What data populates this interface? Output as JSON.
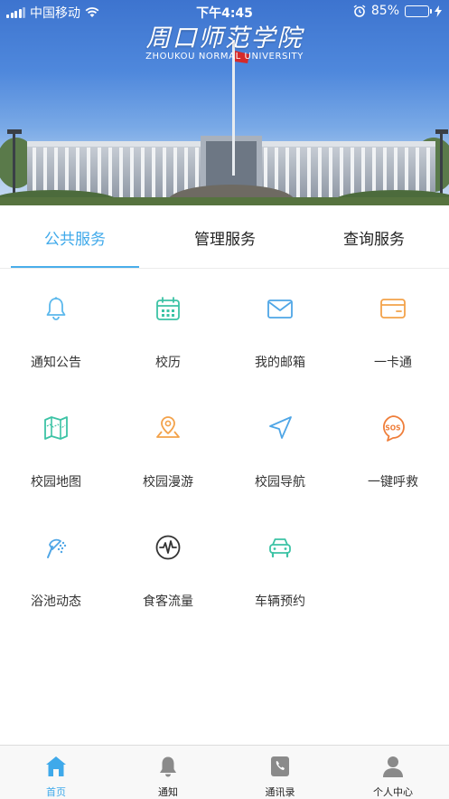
{
  "status_bar": {
    "carrier": "中国移动",
    "time": "下午4:45",
    "battery_percent": "85%",
    "battery_level": 0.85
  },
  "hero": {
    "title": "周口师范学院",
    "subtitle": "ZHOUKOU NORMAL UNIVERSITY"
  },
  "tabs": [
    {
      "label": "公共服务",
      "active": true
    },
    {
      "label": "管理服务",
      "active": false
    },
    {
      "label": "查询服务",
      "active": false
    }
  ],
  "services": [
    {
      "label": "通知公告",
      "icon": "bell-icon",
      "color": "#5bb8ec"
    },
    {
      "label": "校历",
      "icon": "calendar-icon",
      "color": "#3cc3a5"
    },
    {
      "label": "我的邮箱",
      "icon": "mail-icon",
      "color": "#4fa6e6"
    },
    {
      "label": "一卡通",
      "icon": "card-icon",
      "color": "#f3a24a"
    },
    {
      "label": "校园地图",
      "icon": "map-icon",
      "color": "#3cc3a5"
    },
    {
      "label": "校园漫游",
      "icon": "location-pin-icon",
      "color": "#f3a24a"
    },
    {
      "label": "校园导航",
      "icon": "navigation-arrow-icon",
      "color": "#4fa6e6"
    },
    {
      "label": "一键呼救",
      "icon": "sos-icon",
      "color": "#ef7e3a"
    },
    {
      "label": "浴池动态",
      "icon": "shower-icon",
      "color": "#4fa6e6"
    },
    {
      "label": "食客流量",
      "icon": "pulse-icon",
      "color": "#333333"
    },
    {
      "label": "车辆预约",
      "icon": "car-icon",
      "color": "#3cc3a5"
    }
  ],
  "bottom_nav": [
    {
      "label": "首页",
      "icon": "home-icon",
      "active": true
    },
    {
      "label": "通知",
      "icon": "bell-icon",
      "active": false
    },
    {
      "label": "通讯录",
      "icon": "contacts-icon",
      "active": false
    },
    {
      "label": "个人中心",
      "icon": "user-icon",
      "active": false
    }
  ],
  "colors": {
    "accent": "#3fa9ea",
    "nav_inactive": "#8a8a8a"
  }
}
